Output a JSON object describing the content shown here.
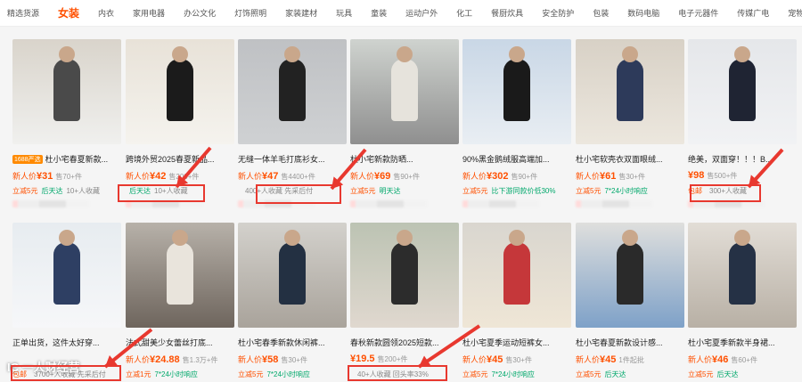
{
  "nav": {
    "items": [
      "精选货源",
      "女装",
      "内衣",
      "家用电器",
      "办公文化",
      "灯饰照明",
      "家装建材",
      "玩具",
      "童装",
      "运动户外",
      "化工",
      "餐厨炊具",
      "安全防护",
      "包装",
      "数码电脑",
      "电子元器件",
      "传媒广电",
      "宠物园"
    ],
    "active_index": 1
  },
  "products": [
    {
      "tag": "1688严选",
      "title": "杜小宅春夏新款...",
      "new_label": "新人价",
      "price": "¥31",
      "sold": "售70+件",
      "ship": "立减5元",
      "speed": "后天达",
      "note": "10+人收藏"
    },
    {
      "tag": "",
      "title": "跨境外贸2025春夏新品...",
      "new_label": "新人价",
      "price": "¥42",
      "sold": "售200+件",
      "ship": "",
      "speed": "后天达",
      "note": "10+人收藏"
    },
    {
      "tag": "",
      "title": "无缝一体羊毛打底衫女...",
      "new_label": "新人价",
      "price": "¥47",
      "sold": "售4400+件",
      "ship": "",
      "speed": "",
      "note": "400+人收藏  先采后付"
    },
    {
      "tag": "",
      "title": "杜小宅新款防晒...",
      "new_label": "新人价",
      "price": "¥69",
      "sold": "售90+件",
      "ship": "立减5元",
      "speed": "明天达",
      "note": ""
    },
    {
      "tag": "",
      "title": "90%黑金鹅绒服高端加...",
      "new_label": "新人价",
      "price": "¥302",
      "sold": "售90+件",
      "ship": "立减5元",
      "speed": "比下游同款价低30%",
      "note": ""
    },
    {
      "tag": "",
      "title": "杜小宅软壳衣双面眼绒...",
      "new_label": "新人价",
      "price": "¥61",
      "sold": "售30+件",
      "ship": "立减5元",
      "speed": "7*24小时响应",
      "note": ""
    },
    {
      "tag": "",
      "title": "绝美，双面穿！！！B...",
      "new_label": "",
      "price": "¥98",
      "sold": "售500+件",
      "ship": "包邮",
      "speed": "",
      "note": "300+人收藏"
    },
    {
      "tag": "",
      "title": "正单出货，这件太好穿...",
      "new_label": "",
      "price": "",
      "sold": "",
      "ship": "包邮",
      "speed": "",
      "note": "3700+人收藏  先采后付"
    },
    {
      "tag": "",
      "title": "法式甜美少女蕾丝打底...",
      "new_label": "新人价",
      "price": "¥24.88",
      "sold": "售1.3万+件",
      "ship": "立减1元",
      "speed": "7*24小时响应",
      "note": ""
    },
    {
      "tag": "",
      "title": "杜小宅春季新款休闲裤...",
      "new_label": "新人价",
      "price": "¥58",
      "sold": "售30+件",
      "ship": "立减5元",
      "speed": "7*24小时响应",
      "note": ""
    },
    {
      "tag": "",
      "title": "春秋新款圆领2025短款...",
      "new_label": "",
      "price": "¥19.5",
      "sold": "售200+件",
      "ship": "",
      "speed": "",
      "note": "40+人收藏  回头率33%"
    },
    {
      "tag": "",
      "title": "杜小宅夏季运动短裤女...",
      "new_label": "新人价",
      "price": "¥45",
      "sold": "售30+件",
      "ship": "立减5元",
      "speed": "7*24小时响应",
      "note": ""
    },
    {
      "tag": "",
      "title": "杜小宅春夏新款设计感...",
      "new_label": "新人价",
      "price": "¥45",
      "sold": "1件起批",
      "ship": "立减5元",
      "speed": "后天达",
      "note": ""
    },
    {
      "tag": "",
      "title": "杜小宅夏季新款半身裙...",
      "new_label": "新人价",
      "price": "¥46",
      "sold": "售60+件",
      "ship": "立减5元",
      "speed": "后天达",
      "note": ""
    }
  ],
  "watermark": "IC 一人财经营",
  "colors": {
    "accent": "#ff5000",
    "highlight": "#e8382f",
    "green": "#00a86b"
  }
}
